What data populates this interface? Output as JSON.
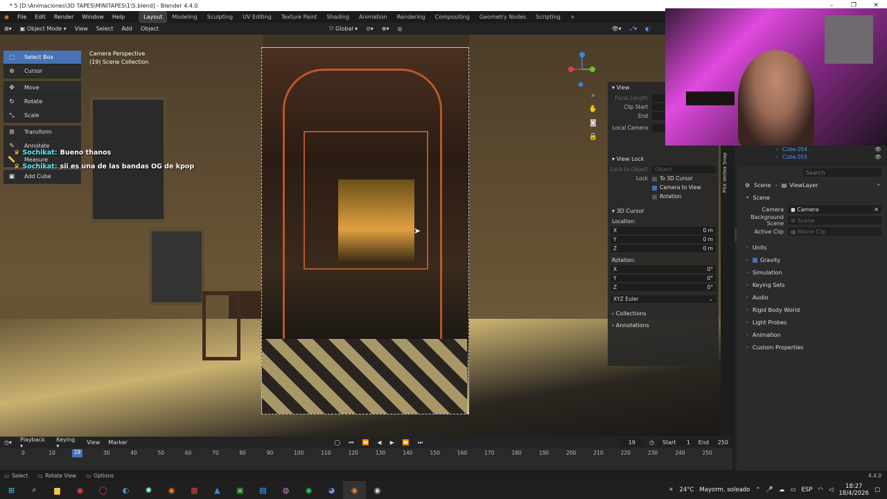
{
  "window": {
    "title": "* 5 [D:\\Animaciones\\3D TAPES\\MINITAPES\\1\\5.blend] - Blender 4.4.0",
    "controls": [
      "–",
      "❐",
      "✕"
    ]
  },
  "menu": {
    "items": [
      "File",
      "Edit",
      "Render",
      "Window",
      "Help"
    ],
    "workspaces": [
      "Layout",
      "Modeling",
      "Sculpting",
      "UV Editing",
      "Texture Paint",
      "Shading",
      "Animation",
      "Rendering",
      "Compositing",
      "Geometry Nodes",
      "Scripting"
    ],
    "active_workspace": "Layout",
    "add_tab": "+"
  },
  "viewport_header": {
    "mode": "Object Mode",
    "menus": [
      "View",
      "Select",
      "Add",
      "Object"
    ],
    "orientation": "Global"
  },
  "viewport": {
    "camera_label": "Camera Perspective",
    "collection_label": "(19) Scene Collection"
  },
  "toolbar": {
    "tools": [
      {
        "label": "Select Box",
        "icon": "select-box-icon",
        "active": true
      },
      {
        "label": "Cursor",
        "icon": "cursor-icon",
        "active": false
      },
      {
        "label": "Move",
        "icon": "move-icon",
        "active": false
      },
      {
        "label": "Rotate",
        "icon": "rotate-icon",
        "active": false
      },
      {
        "label": "Scale",
        "icon": "scale-icon",
        "active": false
      },
      {
        "label": "Transform",
        "icon": "transform-icon",
        "active": false
      },
      {
        "label": "Annotate",
        "icon": "annotate-icon",
        "active": false
      },
      {
        "label": "Measure",
        "icon": "measure-icon",
        "active": false
      },
      {
        "label": "Add Cube",
        "icon": "add-cube-icon",
        "active": false
      }
    ]
  },
  "chat": [
    {
      "user": "Sochikat:",
      "message": "Bueno thanos"
    },
    {
      "user": "Sochikat:",
      "message": "sii es una de las bandas OG de kpop"
    }
  ],
  "npanel": {
    "view_title": "View",
    "focal_length": "Focal Length",
    "clip_start": "Clip Start",
    "end": "End",
    "local_camera": "Local Camera",
    "view_lock_title": "View Lock",
    "lock_to_object": "Lock to Object",
    "lock_object_placeholder": "Object",
    "lock": "Lock",
    "to_3d_cursor": "To 3D Cursor",
    "camera_to_view": "Camera to View",
    "rotation_opt": "Rotation",
    "cursor_title": "3D Cursor",
    "location": "Location:",
    "loc": [
      {
        "axis": "X",
        "value": "0 m"
      },
      {
        "axis": "Y",
        "value": "0 m"
      },
      {
        "axis": "Z",
        "value": "0 m"
      }
    ],
    "rotation": "Rotation:",
    "rot": [
      {
        "axis": "X",
        "value": "0°"
      },
      {
        "axis": "Y",
        "value": "0°"
      },
      {
        "axis": "Z",
        "value": "0°"
      }
    ],
    "euler": "XYZ Euler",
    "collections": "Collections",
    "annotations": "Annotations"
  },
  "outliner": {
    "rows": [
      "Cube.054",
      "Cube.055"
    ]
  },
  "properties": {
    "search_placeholder": "Search",
    "breadcrumb_scene": "Scene",
    "breadcrumb_layer": "ViewLayer",
    "scene_section": "Scene",
    "camera_label": "Camera",
    "camera_value": "Camera",
    "background_label": "Background Scene",
    "background_value": "Scene",
    "clip_label": "Active Clip",
    "clip_value": "Movie Clip",
    "sections": [
      "Units",
      "Gravity",
      "Simulation",
      "Keying Sets",
      "Audio",
      "Rigid Body World",
      "Light Probes",
      "Animation",
      "Custom Properties"
    ]
  },
  "vertical_tab": "PSX Vertex Snap",
  "timeline": {
    "menus": [
      "Playback",
      "Keying",
      "View",
      "Marker"
    ],
    "current_frame": "19",
    "start_label": "Start",
    "start_value": "1",
    "end_label": "End",
    "end_value": "250",
    "ticks": [
      "0",
      "10",
      "30",
      "40",
      "50",
      "60",
      "70",
      "80",
      "90",
      "100",
      "110",
      "120",
      "130",
      "140",
      "150",
      "160",
      "170",
      "180",
      "190",
      "200",
      "210",
      "220",
      "230",
      "240",
      "250"
    ],
    "playhead": "19"
  },
  "statusbar": {
    "select": "Select",
    "rotate_view": "Rotate View",
    "options": "Options",
    "version": "4.4.0"
  },
  "taskbar": {
    "weather_temp": "24°C",
    "weather_desc": "Mayorm. soleado",
    "lang": "ESP",
    "time": "18:27",
    "date": "18/4/2026"
  },
  "colors": {
    "accent": "#4772b3",
    "chat_user": "#5ff0ff",
    "outliner_object": "#5a8ef0",
    "axis_x": "#e04040",
    "axis_y": "#70c030",
    "axis_z": "#3f7fe0"
  }
}
